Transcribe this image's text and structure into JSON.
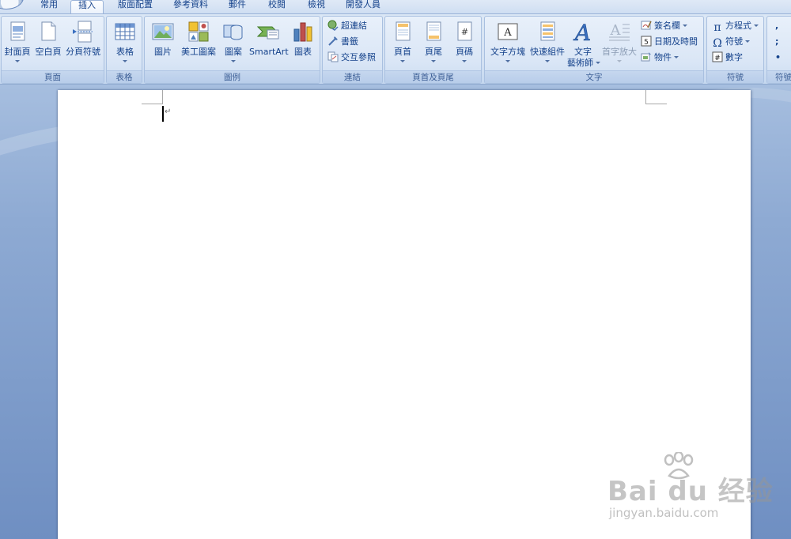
{
  "tabs": [
    {
      "label": "常用",
      "active": false
    },
    {
      "label": "插入",
      "active": true
    },
    {
      "label": "版面配置",
      "active": false
    },
    {
      "label": "參考資料",
      "active": false
    },
    {
      "label": "郵件",
      "active": false
    },
    {
      "label": "校閱",
      "active": false
    },
    {
      "label": "檢視",
      "active": false
    },
    {
      "label": "開發人員",
      "active": false
    }
  ],
  "ribbon": {
    "pages": {
      "label": "頁面",
      "cover_page": "封面頁",
      "blank_page": "空白頁",
      "page_break": "分頁符號"
    },
    "tables": {
      "label": "表格",
      "table": "表格"
    },
    "illustrations": {
      "label": "圖例",
      "picture": "圖片",
      "clip_art": "美工圖案",
      "shapes": "圖案",
      "smartart": "SmartArt",
      "chart": "圖表"
    },
    "links": {
      "label": "連結",
      "hyperlink": "超連結",
      "bookmark": "書籤",
      "cross_reference": "交互參照"
    },
    "header_footer": {
      "label": "頁首及頁尾",
      "header": "頁首",
      "footer": "頁尾",
      "page_number": "頁碼"
    },
    "text": {
      "label": "文字",
      "text_box": "文字方塊",
      "quick_parts": "快速組件",
      "wordart_line1": "文字",
      "wordart_line2": "藝術師",
      "drop_cap": "首字放大",
      "signature_line": "簽名欄",
      "date_time": "日期及時間",
      "object": "物件"
    },
    "symbols": {
      "label": "符號",
      "equation": "方程式",
      "symbol": "符號",
      "number": "數字"
    },
    "special": {
      "label": "符號"
    }
  },
  "watermark": {
    "brand": "Bai du 经验",
    "url": "jingyan.baidu.com"
  },
  "colors": {
    "ribbon_text": "#15428b",
    "group_label": "#3d5f96",
    "doc_background": "#8eaad3"
  }
}
